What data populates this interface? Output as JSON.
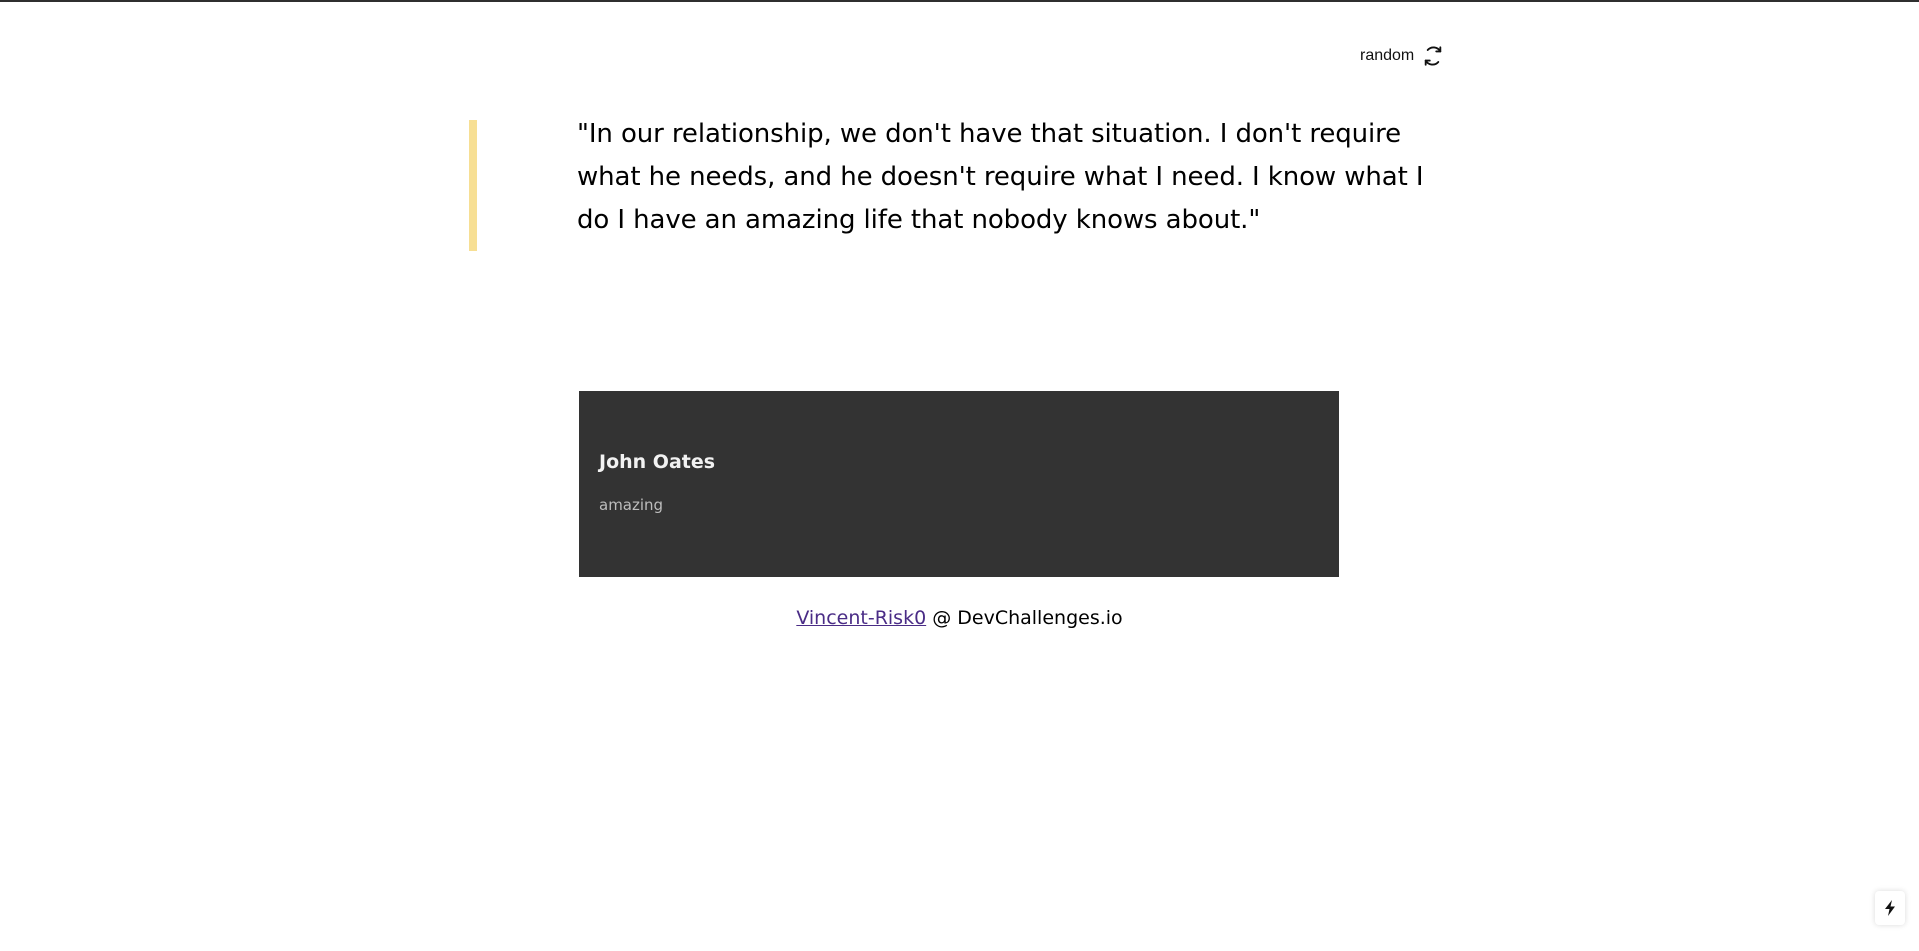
{
  "header": {
    "random_label": "random",
    "random_icon": "refresh-icon"
  },
  "quote": {
    "text": "\"In our relationship, we don't have that situation. I don't require what he needs, and he doesn't require what I need. I know what I do I have an amazing life that nobody knows about.\"",
    "accent_color": "#f7df94"
  },
  "author": {
    "name": "John Oates",
    "genre": "amazing",
    "card_color": "#333333"
  },
  "footer": {
    "link_text": "Vincent-Risk0",
    "separator": "@",
    "site": "DevChallenges.io"
  },
  "corner_widget": {
    "icon": "bolt-icon"
  }
}
